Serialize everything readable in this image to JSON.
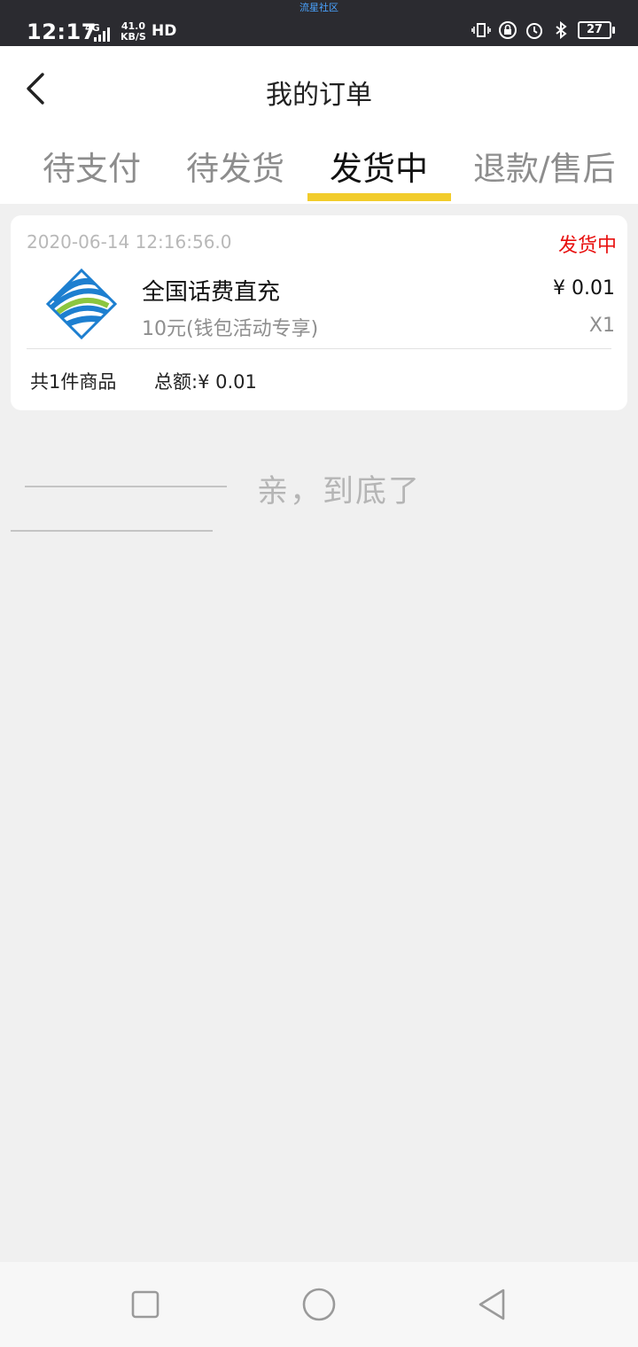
{
  "statusbar": {
    "time": "12:17",
    "network": "4G",
    "speed_value": "41.0",
    "speed_unit": "KB/S",
    "hd": "HD",
    "top_label": "流星社区",
    "battery": "27"
  },
  "header": {
    "title": "我的订单",
    "tabs": [
      {
        "label": "待支付"
      },
      {
        "label": "待发货"
      },
      {
        "label": "发货中"
      },
      {
        "label": "退款/售后"
      }
    ]
  },
  "order": {
    "date": "2020-06-14  12:16:56.0",
    "status": "发货中",
    "product_name": "全国话费直充",
    "product_desc": "10元(钱包活动专享)",
    "price": "¥ 0.01",
    "qty": "X1",
    "count": "共1件商品",
    "total": "总额:¥ 0.01"
  },
  "footer_text": "亲，到底了",
  "colors": {
    "accent": "#f2cc2b",
    "status_red": "#e8100f"
  }
}
